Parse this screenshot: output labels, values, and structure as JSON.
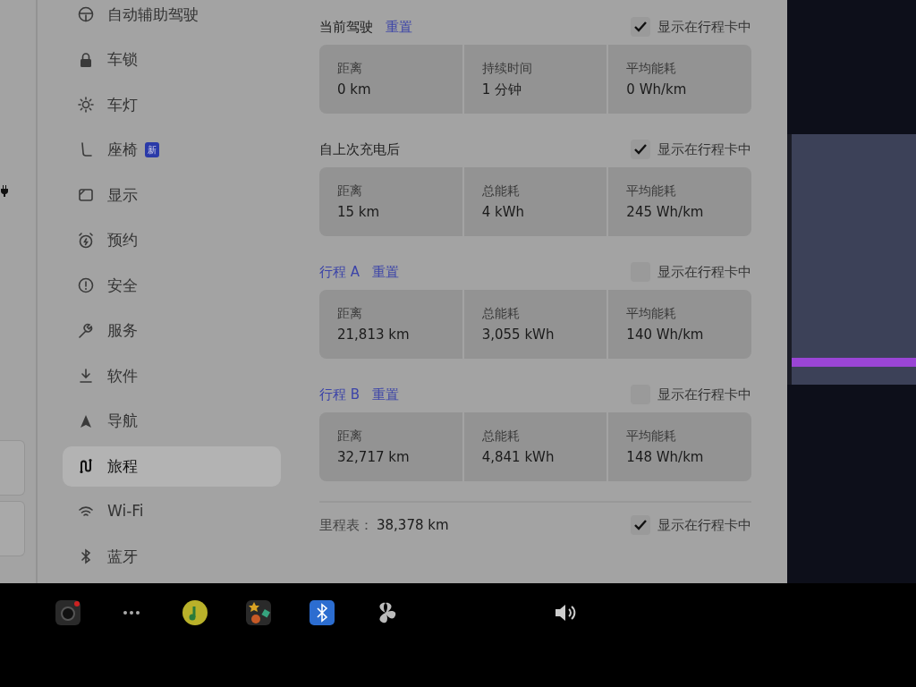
{
  "sidebar": {
    "items": [
      {
        "label": "自动辅助驾驶",
        "selected": false
      },
      {
        "label": "车锁",
        "selected": false
      },
      {
        "label": "车灯",
        "selected": false
      },
      {
        "label": "座椅",
        "selected": false,
        "badge": "新"
      },
      {
        "label": "显示",
        "selected": false
      },
      {
        "label": "预约",
        "selected": false
      },
      {
        "label": "安全",
        "selected": false
      },
      {
        "label": "服务",
        "selected": false
      },
      {
        "label": "软件",
        "selected": false
      },
      {
        "label": "导航",
        "selected": false
      },
      {
        "label": "旅程",
        "selected": true
      },
      {
        "label": "Wi-Fi",
        "selected": false
      },
      {
        "label": "蓝牙",
        "selected": false
      }
    ]
  },
  "sections": [
    {
      "title": "当前驾驶",
      "title_link": false,
      "reset": "重置",
      "show_in_card": {
        "label": "显示在行程卡中",
        "checked": true
      },
      "stats": [
        {
          "label": "距离",
          "value": "0 km"
        },
        {
          "label": "持续时间",
          "value": "1 分钟"
        },
        {
          "label": "平均能耗",
          "value": "0 Wh/km"
        }
      ]
    },
    {
      "title": "自上次充电后",
      "title_link": false,
      "show_in_card": {
        "label": "显示在行程卡中",
        "checked": true
      },
      "stats": [
        {
          "label": "距离",
          "value": "15 km"
        },
        {
          "label": "总能耗",
          "value": "4 kWh"
        },
        {
          "label": "平均能耗",
          "value": "245 Wh/km"
        }
      ]
    },
    {
      "title": "行程 A",
      "title_link": true,
      "reset": "重置",
      "show_in_card": {
        "label": "显示在行程卡中",
        "checked": false
      },
      "stats": [
        {
          "label": "距离",
          "value": "21,813 km"
        },
        {
          "label": "总能耗",
          "value": "3,055 kWh"
        },
        {
          "label": "平均能耗",
          "value": "140 Wh/km"
        }
      ]
    },
    {
      "title": "行程 B",
      "title_link": true,
      "reset": "重置",
      "show_in_card": {
        "label": "显示在行程卡中",
        "checked": false
      },
      "stats": [
        {
          "label": "距离",
          "value": "32,717 km"
        },
        {
          "label": "总能耗",
          "value": "4,841 kWh"
        },
        {
          "label": "平均能耗",
          "value": "148 Wh/km"
        }
      ]
    }
  ],
  "odometer": {
    "label": "里程表：",
    "value": "38,378 km",
    "show_in_card": {
      "label": "显示在行程卡中",
      "checked": true
    }
  }
}
